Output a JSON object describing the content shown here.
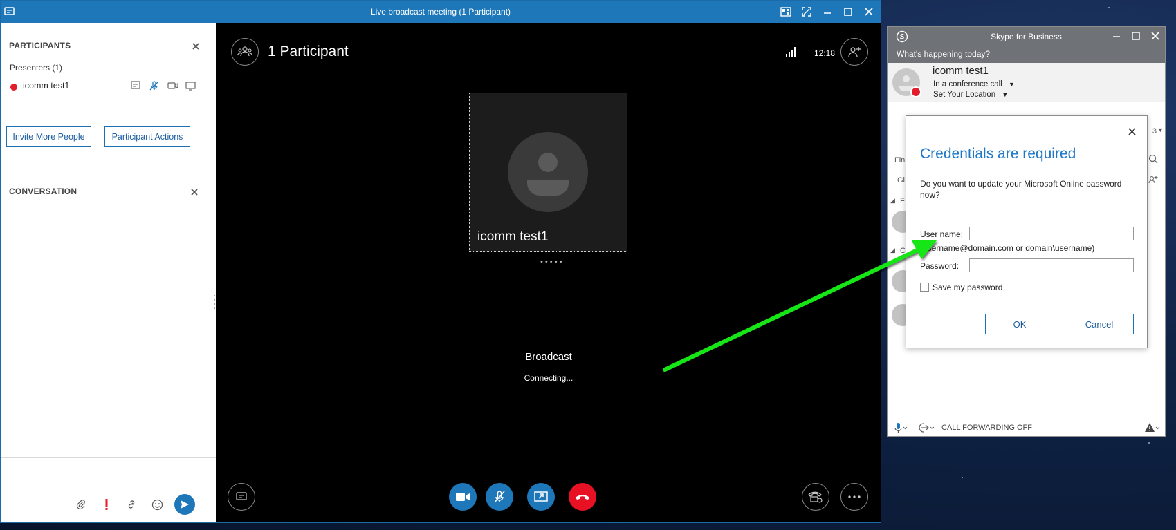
{
  "meeting_window": {
    "title": "Live broadcast meeting (1 Participant)",
    "participants_pane": {
      "header": "PARTICIPANTS",
      "presenters_label": "Presenters (1)",
      "presenter_name": "icomm test1",
      "invite_button": "Invite More People",
      "actions_button": "Participant Actions"
    },
    "conversation_pane": {
      "header": "CONVERSATION"
    },
    "stage": {
      "participant_count": "1 Participant",
      "time": "12:18",
      "tile_name": "icomm test1",
      "broadcast_label": "Broadcast",
      "status_label": "Connecting..."
    }
  },
  "skype_window": {
    "title": "Skype for Business",
    "whats_happening": "What's happening today?",
    "user_name": "icomm test1",
    "presence_state": "In a conference call",
    "location": "Set Your Location",
    "call_forwarding": "CALL FORWARDING OFF",
    "partial_labels": {
      "find": "Fin",
      "groups": "Gl",
      "f": "F",
      "c": "C",
      "three": "3"
    }
  },
  "credentials_dialog": {
    "title": "Credentials are required",
    "question": "Do you want to update your Microsoft Online password now?",
    "username_label": "User name:",
    "username_value": "",
    "username_hint": "(username@domain.com or domain\\username)",
    "password_label": "Password:",
    "password_value": "",
    "save_password_label": "Save my password",
    "save_password_checked": false,
    "ok_button": "OK",
    "cancel_button": "Cancel"
  },
  "colors": {
    "accent_blue": "#1d77b8",
    "hangup_red": "#e81123",
    "presence_red": "#e21e2c",
    "annotation_green": "#19e619"
  }
}
